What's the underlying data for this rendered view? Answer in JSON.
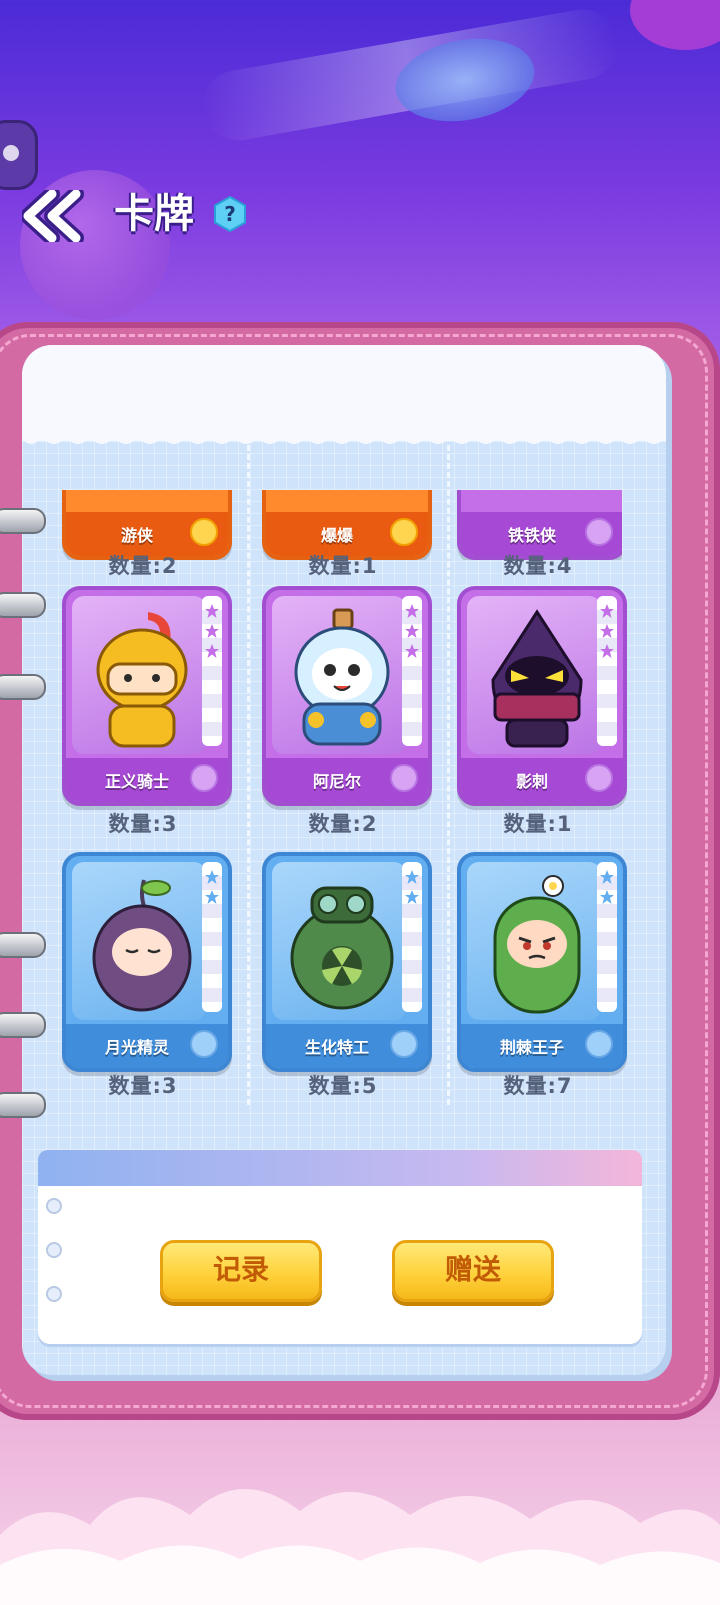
{
  "header": {
    "title": "卡牌",
    "back_icon": "double-chevron-left-icon",
    "help_label": "?"
  },
  "rows": [
    {
      "cards": [
        {
          "name": "游侠",
          "count": "数量:2",
          "color": "orange"
        },
        {
          "name": "爆爆",
          "count": "数量:1",
          "color": "orange"
        },
        {
          "name": "铁铁侠",
          "count": "数量:4",
          "color": "purple"
        }
      ]
    },
    {
      "cards": [
        {
          "name": "正义骑士",
          "count": "数量:3",
          "color": "purple",
          "stars": 3
        },
        {
          "name": "阿尼尔",
          "count": "数量:2",
          "color": "purple",
          "stars": 3
        },
        {
          "name": "影刺",
          "count": "数量:1",
          "color": "purple",
          "stars": 3
        }
      ]
    },
    {
      "cards": [
        {
          "name": "月光精灵",
          "count": "数量:3",
          "color": "blue",
          "stars": 2
        },
        {
          "name": "生化特工",
          "count": "数量:5",
          "color": "blue",
          "stars": 2
        },
        {
          "name": "荆棘王子",
          "count": "数量:7",
          "color": "blue",
          "stars": 2
        }
      ]
    }
  ],
  "actions": {
    "record_label": "记录",
    "gift_label": "赠送"
  },
  "colors": {
    "orange": "#ff8a2e",
    "purple": "#c46ee8",
    "blue": "#63aef0",
    "button": "#ffd23c"
  }
}
